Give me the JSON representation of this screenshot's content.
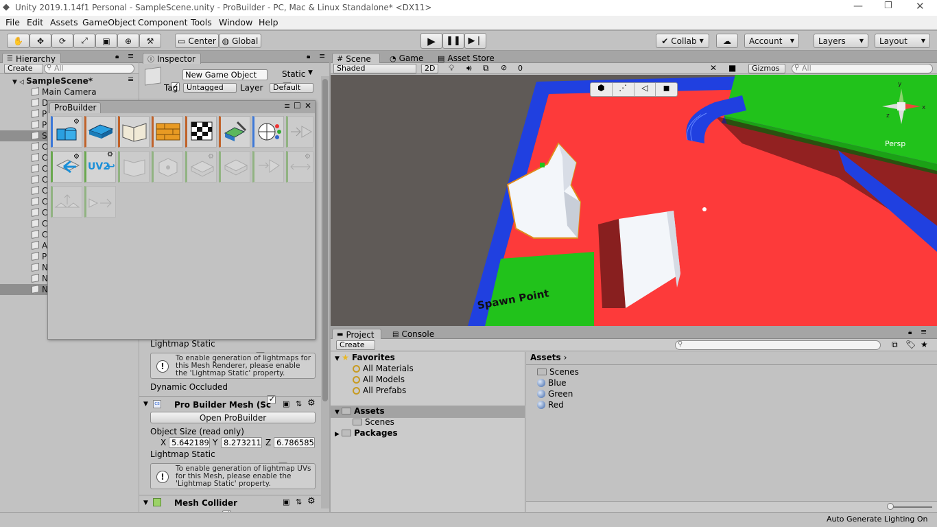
{
  "window": {
    "title": "Unity 2019.1.14f1 Personal - SampleScene.unity - ProBuilder - PC, Mac & Linux Standalone* <DX11>"
  },
  "menu": [
    "File",
    "Edit",
    "Assets",
    "GameObject",
    "Component",
    "Tools",
    "Window",
    "Help"
  ],
  "toolbar": {
    "pivot": "Center",
    "space": "Global",
    "collab": "Collab",
    "account": "Account",
    "layers": "Layers",
    "layout": "Layout"
  },
  "hierarchy": {
    "tab": "Hierarchy",
    "create": "Create",
    "search_placeholder": "All",
    "scene": "SampleScene*",
    "items": [
      "Main Camera",
      "D",
      "P",
      "P",
      "S",
      "C",
      "C",
      "C",
      "C",
      "C",
      "C",
      "C",
      "C",
      "C",
      "A",
      "P",
      "N",
      "N",
      "N"
    ]
  },
  "inspector": {
    "tab": "Inspector",
    "object_name": "New Game Object",
    "static_label": "Static",
    "tag_label": "Tag",
    "tag_value": "Untagged",
    "layer_label": "Layer",
    "layer_value": "Default",
    "lightmap_static": "Lightmap Static",
    "lightmap_info": "To enable generation of lightmaps for this Mesh Renderer, please enable the 'Lightmap Static' property.",
    "dynamic_occluded": "Dynamic Occluded",
    "pb_mesh_title": "Pro Builder Mesh (Sc",
    "open_probuilder": "Open ProBuilder",
    "object_size_label": "Object Size (read only)",
    "size": {
      "x": "5.642189",
      "y": "8.273211",
      "z": "6.786585"
    },
    "axis_labels": {
      "x": "X",
      "y": "Y",
      "z": "Z"
    },
    "lightmap_static2": "Lightmap Static",
    "uv_info": "To enable generation of lightmap UVs for this Mesh, please enable the 'Lightmap Static' property.",
    "mesh_collider": "Mesh Collider"
  },
  "probuilder": {
    "title": "ProBuilder",
    "uv2_label": "UV2"
  },
  "scene": {
    "tab": "Scene",
    "game_tab": "Game",
    "store_tab": "Asset Store",
    "shading": "Shaded",
    "mode2d": "2D",
    "hidden_count": "0",
    "gizmos": "Gizmos",
    "search_placeholder": "All",
    "persp": "Persp",
    "spawn_label": "Spawn Point",
    "axis": {
      "x": "x",
      "y": "y",
      "z": "z"
    }
  },
  "project": {
    "tab": "Project",
    "console_tab": "Console",
    "create": "Create",
    "favorites": "Favorites",
    "fav_items": [
      "All Materials",
      "All Models",
      "All Prefabs"
    ],
    "assets": "Assets",
    "assets_children": [
      "Scenes"
    ],
    "packages": "Packages",
    "breadcrumb": "Assets",
    "files": [
      {
        "name": "Scenes",
        "kind": "folder"
      },
      {
        "name": "Blue",
        "kind": "material"
      },
      {
        "name": "Green",
        "kind": "material"
      },
      {
        "name": "Red",
        "kind": "material"
      }
    ]
  },
  "status": {
    "text": "Auto Generate Lighting On"
  },
  "colors": {
    "floor": "#fd3a3a",
    "wall": "#2040e0",
    "green": "#21c21b",
    "ground": "#5f5a57"
  }
}
